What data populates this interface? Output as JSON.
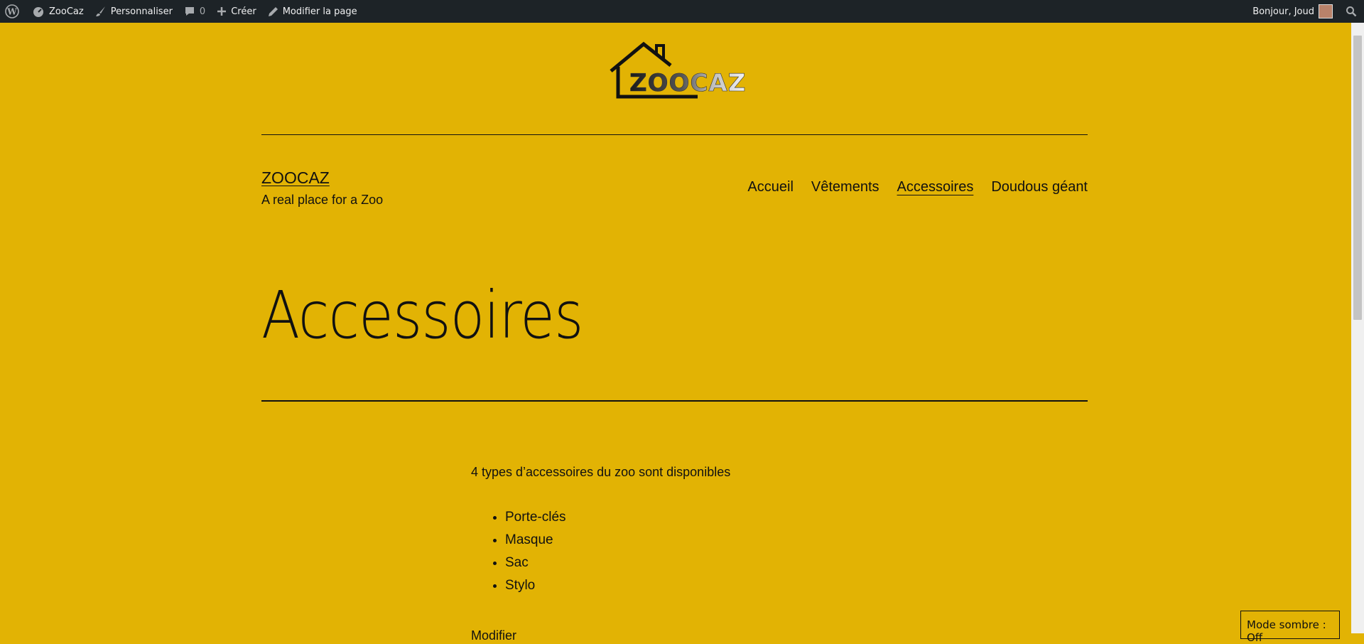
{
  "admin_bar": {
    "site_name": "ZooCaz",
    "customize": "Personnaliser",
    "comments_count": "0",
    "new": "Créer",
    "edit_page": "Modifier la page",
    "greeting": "Bonjour, Joud"
  },
  "header": {
    "logo_text": "ZOOCAZ",
    "site_title": "ZOOCAZ",
    "tagline": "A real place for a Zoo"
  },
  "nav": {
    "items": [
      {
        "label": "Accueil"
      },
      {
        "label": "Vêtements"
      },
      {
        "label": "Accessoires"
      },
      {
        "label": "Doudous géant"
      }
    ],
    "current": "Accessoires"
  },
  "page": {
    "title": "Accessoires",
    "intro": "4 types d’accessoires du zoo sont disponibles",
    "items": [
      "Porte-clés",
      "Masque",
      "Sac",
      "Stylo"
    ],
    "trailing_text": "Modifier"
  },
  "dark_mode": {
    "label": "Mode sombre : Off"
  },
  "colors": {
    "background": "#e2b304",
    "adminbar": "#1d2327",
    "text": "#111111"
  }
}
